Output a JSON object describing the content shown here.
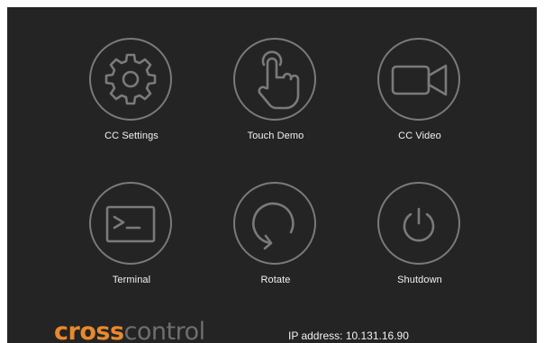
{
  "tiles": [
    {
      "label": "CC Settings",
      "icon": "gear-icon"
    },
    {
      "label": "Touch Demo",
      "icon": "touch-hand-icon"
    },
    {
      "label": "CC Video",
      "icon": "video-camera-icon"
    },
    {
      "label": "Terminal",
      "icon": "terminal-icon"
    },
    {
      "label": "Rotate",
      "icon": "rotate-icon"
    },
    {
      "label": "Shutdown",
      "icon": "power-icon"
    }
  ],
  "logo": {
    "part1": "cross",
    "part2": "control",
    "color_accent": "#e8892c",
    "color_secondary": "#6e6e6e"
  },
  "status": {
    "ip_text": "IP address: 10.131.16.90"
  },
  "colors": {
    "background": "#242424",
    "icon_stroke": "#7a7a7a",
    "text": "#f2f2f2"
  }
}
